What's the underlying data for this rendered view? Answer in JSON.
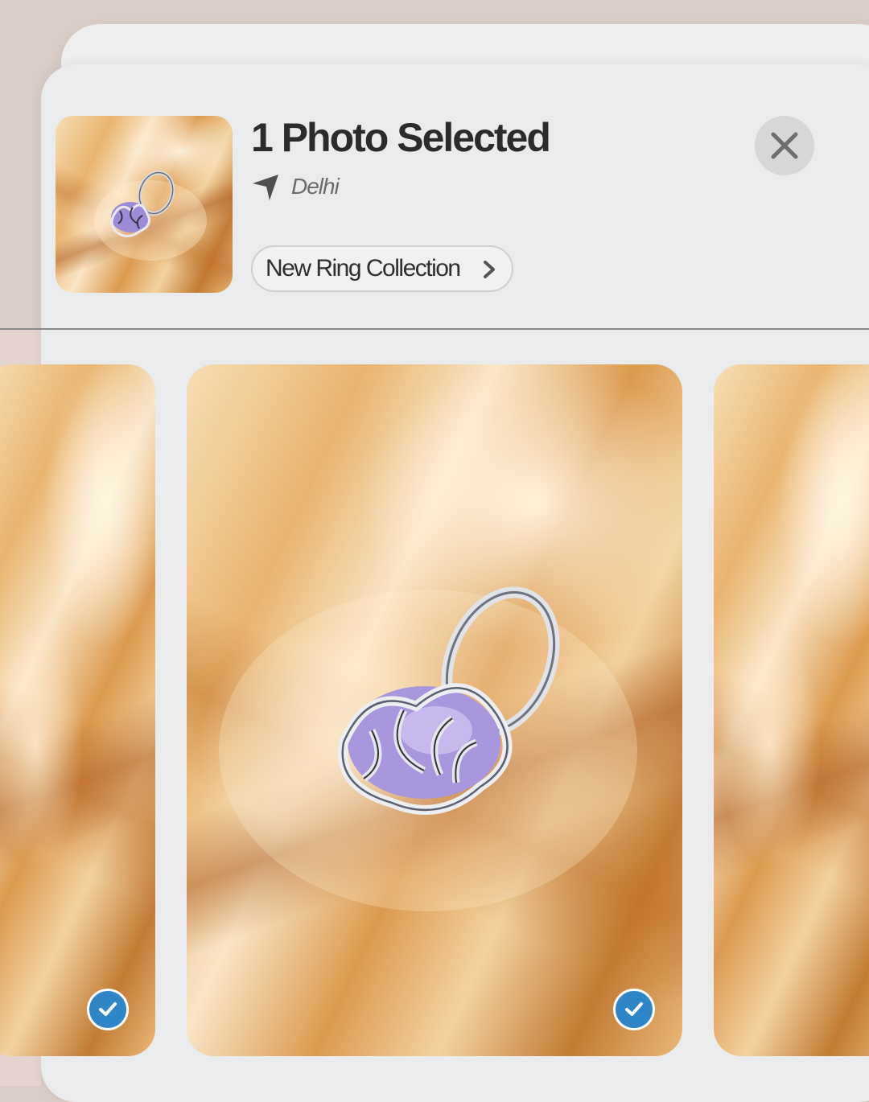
{
  "header": {
    "title": "1 Photo Selected",
    "location": "Delhi",
    "album_label": "New Ring Collection"
  },
  "icons": {
    "location": "location-arrow-icon",
    "album_chevron": "chevron-right-icon",
    "close": "close-icon",
    "selected": "checkmark-icon"
  },
  "colors": {
    "checkmark_badge": "#2f86c6",
    "title_text": "#2b2b2b",
    "sheet_background": "#eaebec",
    "page_background": "#d9ccc6"
  },
  "photos": {
    "left_selected": true,
    "main_selected": true,
    "right_selected": false
  }
}
